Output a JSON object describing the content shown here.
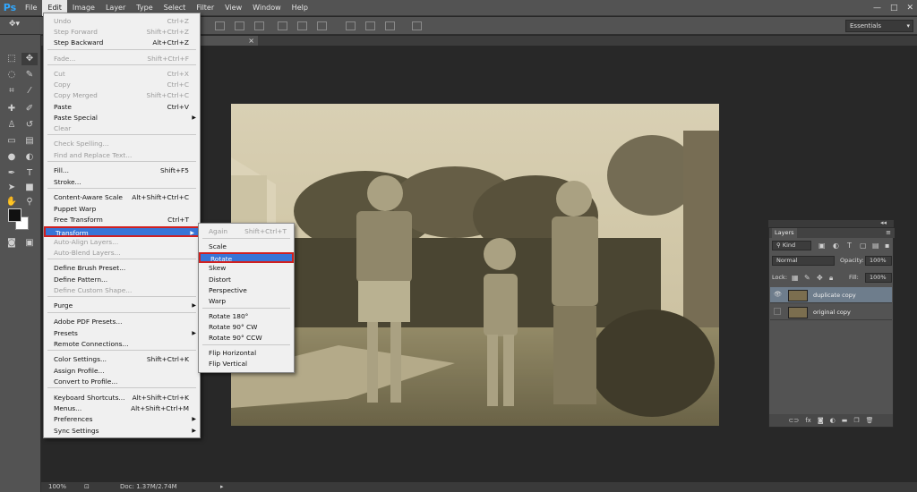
{
  "app": {
    "logo": "Ps"
  },
  "menubar": {
    "items": [
      "File",
      "Edit",
      "Image",
      "Layer",
      "Type",
      "Select",
      "Filter",
      "View",
      "Window",
      "Help"
    ],
    "active": "Edit"
  },
  "window_controls": {
    "minimize": "—",
    "maximize": "□",
    "close": "✕"
  },
  "options_bar": {
    "workspace": "Essentials"
  },
  "edit_menu": {
    "items": [
      {
        "label": "Undo",
        "shortcut": "Ctrl+Z",
        "disabled": true
      },
      {
        "label": "Step Forward",
        "shortcut": "Shift+Ctrl+Z",
        "disabled": true
      },
      {
        "label": "Step Backward",
        "shortcut": "Alt+Ctrl+Z",
        "disabled": false
      },
      {
        "label": "Fade...",
        "shortcut": "Shift+Ctrl+F",
        "disabled": true
      },
      {
        "label": "Cut",
        "shortcut": "Ctrl+X",
        "disabled": true
      },
      {
        "label": "Copy",
        "shortcut": "Ctrl+C",
        "disabled": true
      },
      {
        "label": "Copy Merged",
        "shortcut": "Shift+Ctrl+C",
        "disabled": true
      },
      {
        "label": "Paste",
        "shortcut": "Ctrl+V",
        "disabled": false
      },
      {
        "label": "Paste Special",
        "shortcut": "",
        "disabled": false,
        "submenu": true
      },
      {
        "label": "Clear",
        "shortcut": "",
        "disabled": true
      },
      {
        "label": "Check Spelling...",
        "shortcut": "",
        "disabled": true
      },
      {
        "label": "Find and Replace Text...",
        "shortcut": "",
        "disabled": true
      },
      {
        "label": "Fill...",
        "shortcut": "Shift+F5",
        "disabled": false
      },
      {
        "label": "Stroke...",
        "shortcut": "",
        "disabled": false
      },
      {
        "label": "Content-Aware Scale",
        "shortcut": "Alt+Shift+Ctrl+C",
        "disabled": false
      },
      {
        "label": "Puppet Warp",
        "shortcut": "",
        "disabled": false
      },
      {
        "label": "Free Transform",
        "shortcut": "Ctrl+T",
        "disabled": false
      },
      {
        "label": "Transform",
        "shortcut": "",
        "disabled": false,
        "submenu": true,
        "highlight": true
      },
      {
        "label": "Auto-Align Layers...",
        "shortcut": "",
        "disabled": true
      },
      {
        "label": "Auto-Blend Layers...",
        "shortcut": "",
        "disabled": true
      },
      {
        "label": "Define Brush Preset...",
        "shortcut": "",
        "disabled": false
      },
      {
        "label": "Define Pattern...",
        "shortcut": "",
        "disabled": false
      },
      {
        "label": "Define Custom Shape...",
        "shortcut": "",
        "disabled": true
      },
      {
        "label": "Purge",
        "shortcut": "",
        "disabled": false,
        "submenu": true
      },
      {
        "label": "Adobe PDF Presets...",
        "shortcut": "",
        "disabled": false
      },
      {
        "label": "Presets",
        "shortcut": "",
        "disabled": false,
        "submenu": true
      },
      {
        "label": "Remote Connections...",
        "shortcut": "",
        "disabled": false
      },
      {
        "label": "Color Settings...",
        "shortcut": "Shift+Ctrl+K",
        "disabled": false
      },
      {
        "label": "Assign Profile...",
        "shortcut": "",
        "disabled": false
      },
      {
        "label": "Convert to Profile...",
        "shortcut": "",
        "disabled": false
      },
      {
        "label": "Keyboard Shortcuts...",
        "shortcut": "Alt+Shift+Ctrl+K",
        "disabled": false
      },
      {
        "label": "Menus...",
        "shortcut": "Alt+Shift+Ctrl+M",
        "disabled": false
      },
      {
        "label": "Preferences",
        "shortcut": "",
        "disabled": false,
        "submenu": true
      },
      {
        "label": "Sync Settings",
        "shortcut": "",
        "disabled": false,
        "submenu": true
      }
    ]
  },
  "transform_menu": {
    "items": [
      {
        "label": "Again",
        "shortcut": "Shift+Ctrl+T",
        "disabled": true
      },
      {
        "label": "Scale",
        "shortcut": "",
        "disabled": false
      },
      {
        "label": "Rotate",
        "shortcut": "",
        "disabled": false,
        "highlight": true
      },
      {
        "label": "Skew",
        "shortcut": "",
        "disabled": false
      },
      {
        "label": "Distort",
        "shortcut": "",
        "disabled": false
      },
      {
        "label": "Perspective",
        "shortcut": "",
        "disabled": false
      },
      {
        "label": "Warp",
        "shortcut": "",
        "disabled": false
      },
      {
        "label": "Rotate 180°",
        "shortcut": "",
        "disabled": false
      },
      {
        "label": "Rotate 90° CW",
        "shortcut": "",
        "disabled": false
      },
      {
        "label": "Rotate 90° CCW",
        "shortcut": "",
        "disabled": false
      },
      {
        "label": "Flip Horizontal",
        "shortcut": "",
        "disabled": false
      },
      {
        "label": "Flip Vertical",
        "shortcut": "",
        "disabled": false
      }
    ]
  },
  "layers_panel": {
    "title": "Layers",
    "filter_kind": "Kind",
    "blend_mode": "Normal",
    "opacity_label": "Opacity:",
    "opacity": "100%",
    "lock_label": "Lock:",
    "fill_label": "Fill:",
    "fill": "100%",
    "layers": [
      {
        "name": "duplicate copy",
        "visible": true,
        "selected": true
      },
      {
        "name": "original copy",
        "visible": false,
        "selected": false
      }
    ]
  },
  "status_bar": {
    "zoom": "100%",
    "doc_size": "Doc: 1.37M/2.74M"
  }
}
